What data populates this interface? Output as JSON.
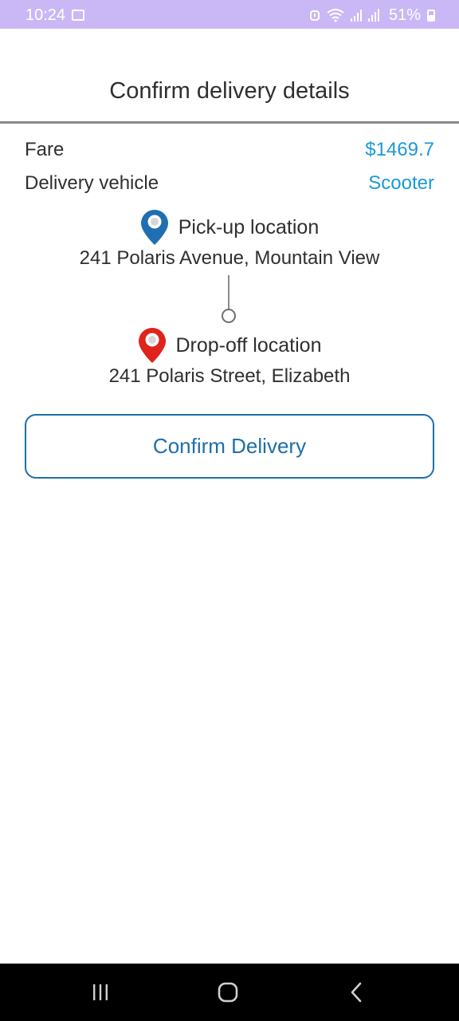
{
  "status_bar": {
    "time": "10:24",
    "battery": "51%",
    "background_color": "#c9b8f5",
    "icons": [
      "gallery-icon",
      "alarm-icon",
      "wifi-icon",
      "signal-icon",
      "battery-icon"
    ]
  },
  "header": {
    "title": "Confirm delivery details"
  },
  "details": {
    "fare_label": "Fare",
    "fare_value": "$1469.7",
    "vehicle_label": "Delivery vehicle",
    "vehicle_value": "Scooter",
    "value_color": "#1a9ad6"
  },
  "pickup": {
    "title": "Pick-up location",
    "address": "241 Polaris Avenue, Mountain View",
    "pin_color": "#1f6fb2",
    "icon": "pickup-pin-icon"
  },
  "dropoff": {
    "title": "Drop-off location",
    "address": "241 Polaris Street, Elizabeth",
    "pin_color": "#e0231b",
    "icon": "dropoff-pin-icon"
  },
  "actions": {
    "confirm_label": "Confirm Delivery",
    "accent_color": "#1f6ea9"
  },
  "nav_bar": {
    "icons": [
      "recent-apps-icon",
      "home-icon",
      "back-icon"
    ]
  }
}
